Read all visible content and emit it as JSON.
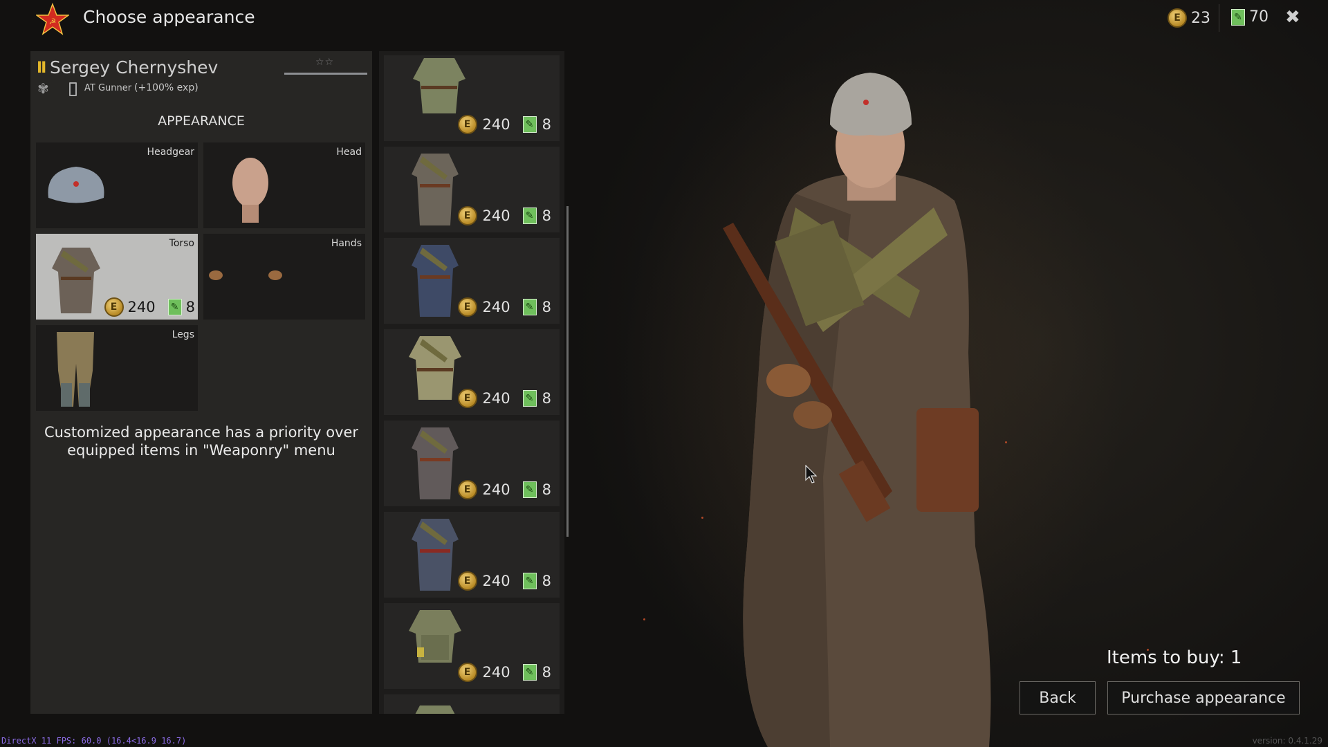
{
  "header": {
    "title": "Choose appearance",
    "currency_silver": "23",
    "currency_tickets": "70"
  },
  "soldier": {
    "rank": "II",
    "name": "Sergey Chernyshev",
    "class_label": "AT Gunner",
    "exp_bonus": "(+100% exp)"
  },
  "appearance": {
    "title": "APPEARANCE",
    "slots": [
      {
        "label": "Headgear"
      },
      {
        "label": "Head"
      },
      {
        "label": "Torso",
        "price": "240",
        "tickets": "8"
      },
      {
        "label": "Hands"
      },
      {
        "label": "Legs"
      }
    ],
    "note_line1": "Customized appearance has a priority over",
    "note_line2": "equipped items in \"Weaponry\" menu"
  },
  "items": [
    {
      "price": "240",
      "tickets": "8"
    },
    {
      "price": "240",
      "tickets": "8"
    },
    {
      "price": "240",
      "tickets": "8"
    },
    {
      "price": "240",
      "tickets": "8"
    },
    {
      "price": "240",
      "tickets": "8"
    },
    {
      "price": "240",
      "tickets": "8"
    },
    {
      "price": "240",
      "tickets": "8"
    }
  ],
  "footer": {
    "items_to_buy": "Items to buy: 1",
    "back_label": "Back",
    "purchase_label": "Purchase appearance",
    "debug": "DirectX 11 FPS: 60.0 (16.4<16.9 16.7)",
    "version": "version: 0.4.1.29"
  },
  "icons": {
    "coin_glyph": "E",
    "ticket_glyph": "✎",
    "close_glyph": "✖",
    "stars_glyph": "☆☆"
  },
  "colors": {
    "accent_gold": "#e3b72b",
    "star_red": "#d22b20",
    "ticket_green": "#6fbf5c"
  }
}
